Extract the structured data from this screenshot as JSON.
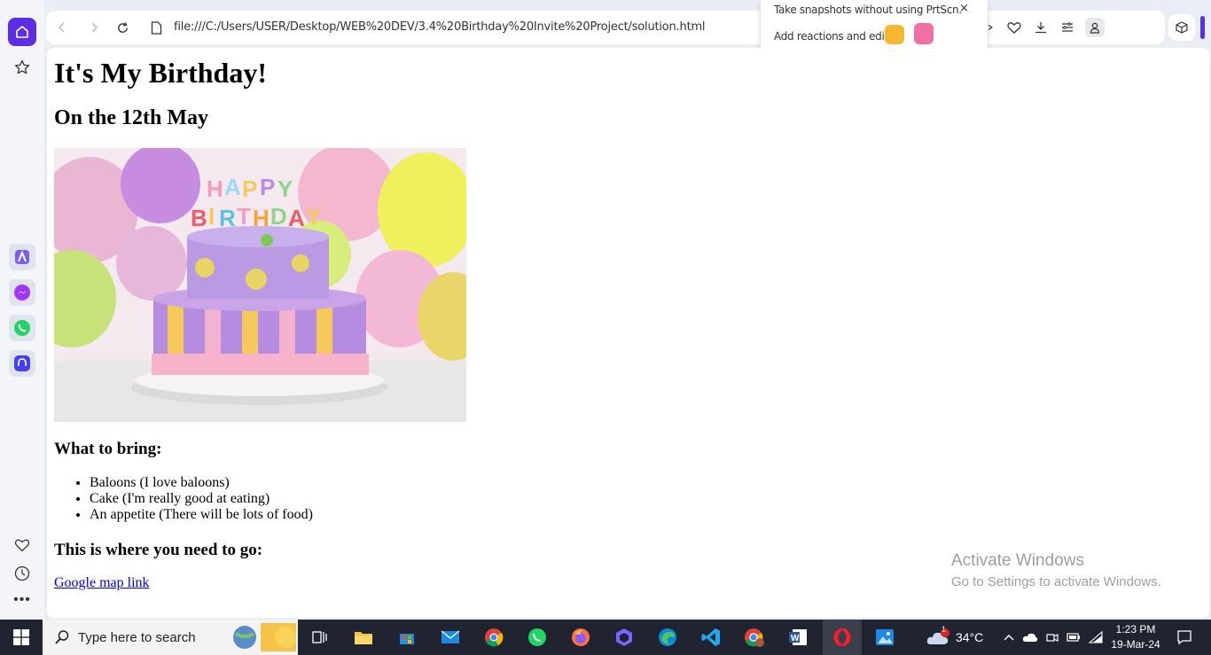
{
  "browser": {
    "url": "file:///C:/Users/USER/Desktop/WEB%20DEV/3.4%20Birthday%20Invite%20Project/solution.html",
    "accent_color": "#5b2ee5",
    "sidebar_icons": [
      "home-icon",
      "star-icon",
      "aria-icon",
      "messenger-icon",
      "whatsapp-icon",
      "music-player-icon",
      "heart-icon",
      "history-icon",
      "more-icon"
    ],
    "toolbar_icons": [
      "back-icon",
      "forward-icon",
      "reload-icon",
      "page-info-icon",
      "camera-icon",
      "play-icon",
      "heart-icon",
      "download-icon",
      "easy-setup-icon",
      "profile-icon",
      "extensions-icon"
    ]
  },
  "popup": {
    "line1": "Take snapshots without using PrtScn.",
    "line2": "Add reactions and edit",
    "close": "×"
  },
  "page": {
    "title": "It's My Birthday!",
    "date": "On the 12th May",
    "image_alt": "birthday cake",
    "bring_heading": "What to bring:",
    "items": [
      "Baloons (I love baloons)",
      "Cake (I'm really good at eating)",
      "An appetite (There will be lots of food)"
    ],
    "where_heading": "This is where you need to go:",
    "map_link": "Google map link"
  },
  "watermark": {
    "line1": "Activate Windows",
    "line2": "Go to Settings to activate Windows."
  },
  "taskbar": {
    "search_placeholder": "Type here to search",
    "temperature": "34°C",
    "weather_badge": "1",
    "time": "1:23 PM",
    "date": "19-Mar-24"
  }
}
